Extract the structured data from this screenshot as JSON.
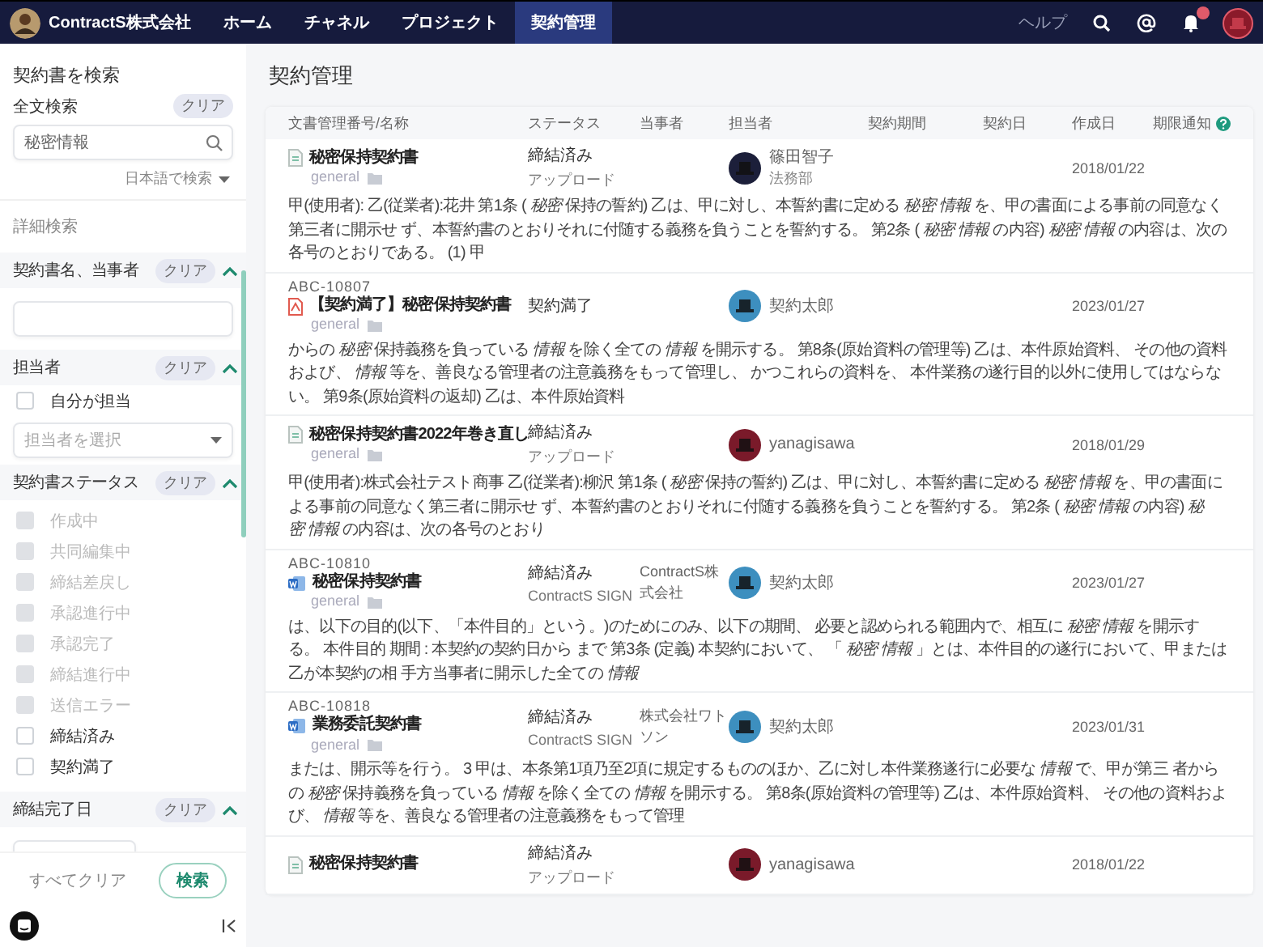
{
  "nav": {
    "company": "ContractS株式会社",
    "tabs": [
      {
        "label": "ホーム",
        "selected": false
      },
      {
        "label": "チャネル",
        "selected": false
      },
      {
        "label": "プロジェクト",
        "selected": false
      },
      {
        "label": "契約管理",
        "selected": true
      }
    ],
    "help": "ヘルプ",
    "notifications_unread": true
  },
  "sidebar": {
    "title": "契約書を検索",
    "fulltext": {
      "label": "全文検索",
      "clear": "クリア",
      "value": "秘密情報",
      "language": "日本語で検索"
    },
    "advanced_label": "詳細検索",
    "sections": [
      {
        "kind": "text",
        "title": "契約書名、当事者",
        "clear": "クリア",
        "expanded": true
      },
      {
        "kind": "person",
        "title": "担当者",
        "clear": "クリア",
        "expanded": true,
        "checkbox": {
          "label": "自分が担当",
          "checked": false
        },
        "select_placeholder": "担当者を選択"
      },
      {
        "kind": "checklist",
        "title": "契約書ステータス",
        "clear": "クリア",
        "expanded": true,
        "options": [
          {
            "label": "作成中",
            "checked": false,
            "disabled": true
          },
          {
            "label": "共同編集中",
            "checked": false,
            "disabled": true
          },
          {
            "label": "締結差戻し",
            "checked": false,
            "disabled": true
          },
          {
            "label": "承認進行中",
            "checked": false,
            "disabled": true
          },
          {
            "label": "承認完了",
            "checked": false,
            "disabled": true
          },
          {
            "label": "締結進行中",
            "checked": false,
            "disabled": true
          },
          {
            "label": "送信エラー",
            "checked": false,
            "disabled": true
          },
          {
            "label": "締結済み",
            "checked": false,
            "disabled": false
          },
          {
            "label": "契約満了",
            "checked": false,
            "disabled": false
          }
        ]
      },
      {
        "kind": "date",
        "title": "締結完了日",
        "clear": "クリア",
        "expanded": true
      }
    ],
    "footer": {
      "clear_all": "すべてクリア",
      "search": "検索"
    }
  },
  "page_title": "契約管理",
  "table": {
    "columns": [
      "文書管理番号/名称",
      "ステータス",
      "当事者",
      "担当者",
      "契約期間",
      "契約日",
      "作成日",
      "期限通知"
    ],
    "rows": [
      {
        "kind": "text",
        "name": "秘密保持契約書",
        "tag": "general",
        "status": "締結済み",
        "status_sub": "アップロード",
        "person": {
          "name": "篠田智子",
          "dept": "法務部",
          "color": "#1c1f3a"
        },
        "created": "2018/01/22",
        "snippet": "甲(使用者): 乙(従業者):花井 第1条 ( *秘密* 保持の誓約) 乙は、甲に対し、本誓約書に定める *秘密* *情報* を、甲の書面による事前の同意なく第三者に開示せ ず、本誓約書のとおりそれに付随する義務を負うことを誓約する。 第2条 ( *秘密* *情報* の内容) *秘密* *情報* の内容は、次の各号のとおりである。 (1) 甲"
      },
      {
        "doc_no": "ABC-10807",
        "kind": "pdf",
        "name": "【契約満了】秘密保持契約書",
        "tag": "general",
        "status": "契約満了",
        "person": {
          "name": "契約太郎",
          "color": "#3d8fbf"
        },
        "created": "2023/01/27",
        "snippet": "からの *秘密* 保持義務を負っている *情報* を除く全ての *情報* を開示する。 第8条(原始資料の管理等) 乙は、本件原始資料、 その他の資料および、 *情報* 等を、善良なる管理者の注意義務をもって管理し、 かつこれらの資料を、 本件業務の遂行目的以外に使用してはならない。 第9条(原始資料の返却) 乙は、本件原始資料"
      },
      {
        "kind": "text",
        "name": "秘密保持契約書2022年巻き直し",
        "tag": "general",
        "status": "締結済み",
        "status_sub": "アップロード",
        "person": {
          "name": "yanagisawa",
          "color": "#7a1a2a"
        },
        "created": "2018/01/29",
        "snippet": "甲(使用者):株式会社テスト商事 乙(従業者):柳沢 第1条 ( *秘密* 保持の誓約) 乙は、甲に対し、本誓約書に定める *秘密* *情報* を、甲の書面による事前の同意なく第三者に開示せ ず、本誓約書のとおりそれに付随する義務を負うことを誓約する。 第2条 ( *秘密* *情報* の内容) *秘密* *情報* の内容は、次の各号のとおり"
      },
      {
        "doc_no": "ABC-10810",
        "kind": "word",
        "name": "秘密保持契約書",
        "tag": "general",
        "status": "締結済み",
        "status_sub": "ContractS SIGN",
        "party": "ContractS株式会社",
        "person": {
          "name": "契約太郎",
          "color": "#3d8fbf"
        },
        "created": "2023/01/27",
        "snippet": "は、以下の目的(以下、「本件目的」という。)のためにのみ、以下の期間、 必要と認められる範囲内で、相互に *秘密* *情報* を開示する。 本件目的 期間 : 本契約の契約日から まで 第3条 (定義) 本契約において、 「 *秘密* *情報* 」とは、本件目的の遂行において、甲または乙が本契約の相 手方当事者に開示した全ての *情報*"
      },
      {
        "doc_no": "ABC-10818",
        "kind": "word",
        "name": "業務委託契約書",
        "tag": "general",
        "status": "締結済み",
        "status_sub": "ContractS SIGN",
        "party": "株式会社ワトソン",
        "person": {
          "name": "契約太郎",
          "color": "#3d8fbf"
        },
        "created": "2023/01/31",
        "snippet": "または、開示等を行う。 3 甲は、本条第1項乃至2項に規定するもののほか、乙に対し本件業務遂行に必要な *情報* で、甲が第三 者からの *秘密* 保持義務を負っている *情報* を除く全ての *情報* を開示する。 第8条(原始資料の管理等) 乙は、本件原始資料、 その他の資料および、 *情報* 等を、善良なる管理者の注意義務をもって管理"
      },
      {
        "kind": "text",
        "name": "秘密保持契約書",
        "status": "締結済み",
        "status_sub": "アップロード",
        "person": {
          "name": "yanagisawa",
          "color": "#7a1a2a"
        },
        "created": "2018/01/22"
      }
    ]
  }
}
